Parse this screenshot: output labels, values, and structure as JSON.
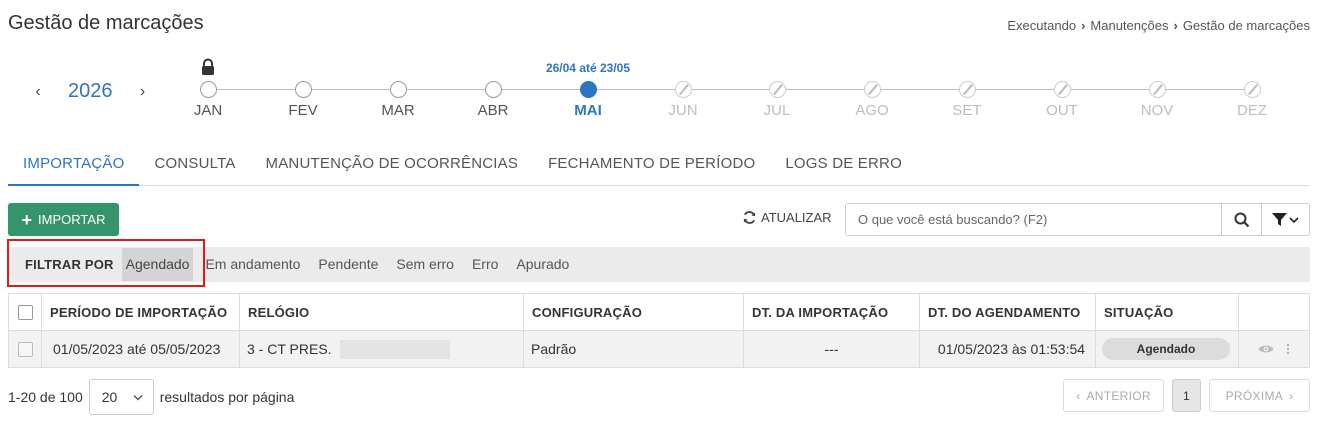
{
  "page": {
    "title": "Gestão de marcações"
  },
  "breadcrumb": [
    "Executando",
    "Manutenções",
    "Gestão de marcações"
  ],
  "year_nav": {
    "year": "2026",
    "prev_icon": "chevron-left-icon",
    "next_icon": "chevron-right-icon"
  },
  "timeline": {
    "range_label": "26/04 até 23/05",
    "months": [
      {
        "label": "JAN",
        "state": "locked"
      },
      {
        "label": "FEV",
        "state": "open"
      },
      {
        "label": "MAR",
        "state": "open"
      },
      {
        "label": "ABR",
        "state": "open"
      },
      {
        "label": "MAI",
        "state": "active"
      },
      {
        "label": "JUN",
        "state": "disabled"
      },
      {
        "label": "JUL",
        "state": "disabled"
      },
      {
        "label": "AGO",
        "state": "disabled"
      },
      {
        "label": "SET",
        "state": "disabled"
      },
      {
        "label": "OUT",
        "state": "disabled"
      },
      {
        "label": "NOV",
        "state": "disabled"
      },
      {
        "label": "DEZ",
        "state": "disabled"
      }
    ]
  },
  "tabs": [
    {
      "label": "IMPORTAÇÃO",
      "active": true
    },
    {
      "label": "CONSULTA",
      "active": false
    },
    {
      "label": "MANUTENÇÃO DE OCORRÊNCIAS",
      "active": false
    },
    {
      "label": "FECHAMENTO DE PERÍODO",
      "active": false
    },
    {
      "label": "LOGS DE ERRO",
      "active": false
    }
  ],
  "toolbar": {
    "import_label": "IMPORTAR",
    "refresh_label": "ATUALIZAR",
    "search_placeholder": "O que você está buscando? (F2)"
  },
  "filters": {
    "title": "FILTRAR POR",
    "options": [
      {
        "label": "Agendado",
        "selected": true
      },
      {
        "label": "Em andamento",
        "selected": false
      },
      {
        "label": "Pendente",
        "selected": false
      },
      {
        "label": "Sem erro",
        "selected": false
      },
      {
        "label": "Erro",
        "selected": false
      },
      {
        "label": "Apurado",
        "selected": false
      }
    ]
  },
  "table": {
    "columns": [
      "PERÍODO DE IMPORTAÇÃO",
      "RELÓGIO",
      "CONFIGURAÇÃO",
      "DT. DA IMPORTAÇÃO",
      "DT. DO AGENDAMENTO",
      "SITUAÇÃO"
    ],
    "rows": [
      {
        "periodo": "01/05/2023 até 05/05/2023",
        "relogio": "3 - CT PRES.",
        "configuracao": "Padrão",
        "dt_importacao": "---",
        "dt_agendamento": "01/05/2023 às 01:53:54",
        "situacao": "Agendado"
      }
    ]
  },
  "pagination": {
    "range_text": "1-20 de 100",
    "page_size": "20",
    "per_page_text": "resultados por página",
    "prev_label": "ANTERIOR",
    "next_label": "PRÓXIMA",
    "current_page": "1"
  },
  "colors": {
    "accent": "#2e74c4",
    "import_button": "#34946a",
    "highlight_border": "#e01b1b"
  }
}
